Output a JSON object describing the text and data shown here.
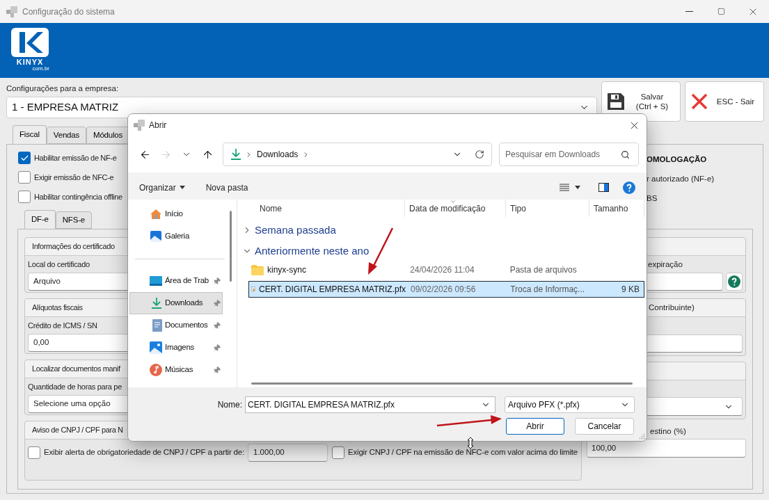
{
  "window": {
    "title": "Configuração do sistema"
  },
  "header": {
    "logo_text": "KINYX",
    "logo_subtext": "com.br"
  },
  "company": {
    "label": "Configurações para a empresa:",
    "value": "1 - EMPRESA MATRIZ"
  },
  "actions": [
    {
      "kind": "save",
      "lines": [
        "Salvar",
        "(Ctrl + S)"
      ]
    },
    {
      "kind": "exit",
      "lines": [
        "ESC - Sair"
      ]
    }
  ],
  "tabs": [
    {
      "label": "Fiscal",
      "selected": true
    },
    {
      "label": "Vendas",
      "selected": false
    },
    {
      "label": "Módulos",
      "selected": false
    }
  ],
  "options": [
    {
      "label": "Habilitar emissão de NF-e",
      "checked": true
    },
    {
      "label": "Exigir emissão de NFC-e",
      "checked": false
    },
    {
      "label": "Habilitar contingência offline",
      "checked": false
    }
  ],
  "right_texts": [
    {
      "kind": "heading",
      "text": "OMOLOGAÇÃO"
    },
    {
      "kind": "plain",
      "text": "r autorizado (NF-e)"
    },
    {
      "kind": "plain",
      "text": "BS"
    }
  ],
  "subtabs": [
    {
      "label": "DF-e",
      "selected": true
    },
    {
      "label": "NFS-e",
      "selected": false
    }
  ],
  "left_groups": [
    {
      "kind": "field",
      "title": "Informações do certificado",
      "field_label": "Local do certificado",
      "value": "Arquivo"
    },
    {
      "kind": "field",
      "title": "Alíquotas fiscais",
      "field_label": "Crédito de ICMS / SN",
      "value": "0,00"
    },
    {
      "kind": "field",
      "title": "Localizar documentos manif",
      "field_label": "Quantidade de horas para pe",
      "value": "Selecione uma opção"
    },
    {
      "kind": "alert",
      "title": "Aviso de CNPJ / CPF para N",
      "items": [
        {
          "kind": "check",
          "label": "Exibir alerta de obrigatoriedade de CNPJ / CPF a partir de:",
          "checked": false
        },
        {
          "kind": "value",
          "value": "1.000,00"
        },
        {
          "kind": "check",
          "label": "Exigir CNPJ / CPF na emissão de NFC-e com valor acima do limite",
          "checked": false
        }
      ]
    }
  ],
  "right_groups": [
    {
      "kind": "help_field",
      "field_label": "expiração"
    },
    {
      "kind": "field",
      "title": "Contribuinte)"
    },
    {
      "kind": "select"
    },
    {
      "kind": "loose",
      "field_label": "estino (%)",
      "value": "100,00"
    }
  ],
  "dialog": {
    "title": "Abrir",
    "nav": [
      {
        "kind": "back",
        "disabled": false
      },
      {
        "kind": "forward",
        "disabled": true
      },
      {
        "kind": "recent",
        "disabled": false
      },
      {
        "kind": "up",
        "disabled": false
      }
    ],
    "location": "Downloads",
    "search": {
      "placeholder": "Pesquisar em Downloads"
    },
    "commands": [
      {
        "kind": "menu",
        "label": "Organizar"
      },
      {
        "kind": "button",
        "label": "Nova pasta"
      }
    ],
    "sidebar": [
      {
        "kind": "home",
        "label": "Início",
        "pinned": false,
        "selected": false
      },
      {
        "kind": "gallery",
        "label": "Galeria",
        "pinned": false,
        "selected": false
      },
      {
        "kind": "separator"
      },
      {
        "kind": "desktop",
        "label": "Área de Trab",
        "pinned": true,
        "selected": false
      },
      {
        "kind": "downloads",
        "label": "Downloads",
        "pinned": true,
        "selected": true
      },
      {
        "kind": "documents",
        "label": "Documentos",
        "pinned": true,
        "selected": false
      },
      {
        "kind": "pictures",
        "label": "Imagens",
        "pinned": true,
        "selected": false
      },
      {
        "kind": "music",
        "label": "Músicas",
        "pinned": true,
        "selected": false
      }
    ],
    "columns": [
      {
        "label": "Nome",
        "sorted": false
      },
      {
        "label": "Data de modificação",
        "sorted": true
      },
      {
        "label": "Tipo",
        "sorted": false
      },
      {
        "label": "Tamanho",
        "sorted": false
      }
    ],
    "groups": [
      {
        "label": "Semana passada",
        "expanded": false
      },
      {
        "label": "Anteriormente neste ano",
        "expanded": true,
        "rows": [
          {
            "kind": "folder",
            "name": "kinyx-sync",
            "date": "24/04/2026 11:04",
            "type": "Pasta de arquivos",
            "selected": false
          },
          {
            "kind": "certificate",
            "name": "CERT. DIGITAL EMPRESA MATRIZ.pfx",
            "date": "09/02/2026 09:56",
            "type": "Troca de Informaç...",
            "size": "9 KB",
            "selected": true
          }
        ]
      }
    ],
    "filename": {
      "label": "Nome:",
      "value": "CERT. DIGITAL EMPRESA MATRIZ.pfx"
    },
    "filetype": "Arquivo PFX (*.pfx)",
    "buttons": [
      {
        "kind": "primary",
        "label": "Abrir"
      },
      {
        "kind": "secondary",
        "label": "Cancelar"
      }
    ]
  }
}
